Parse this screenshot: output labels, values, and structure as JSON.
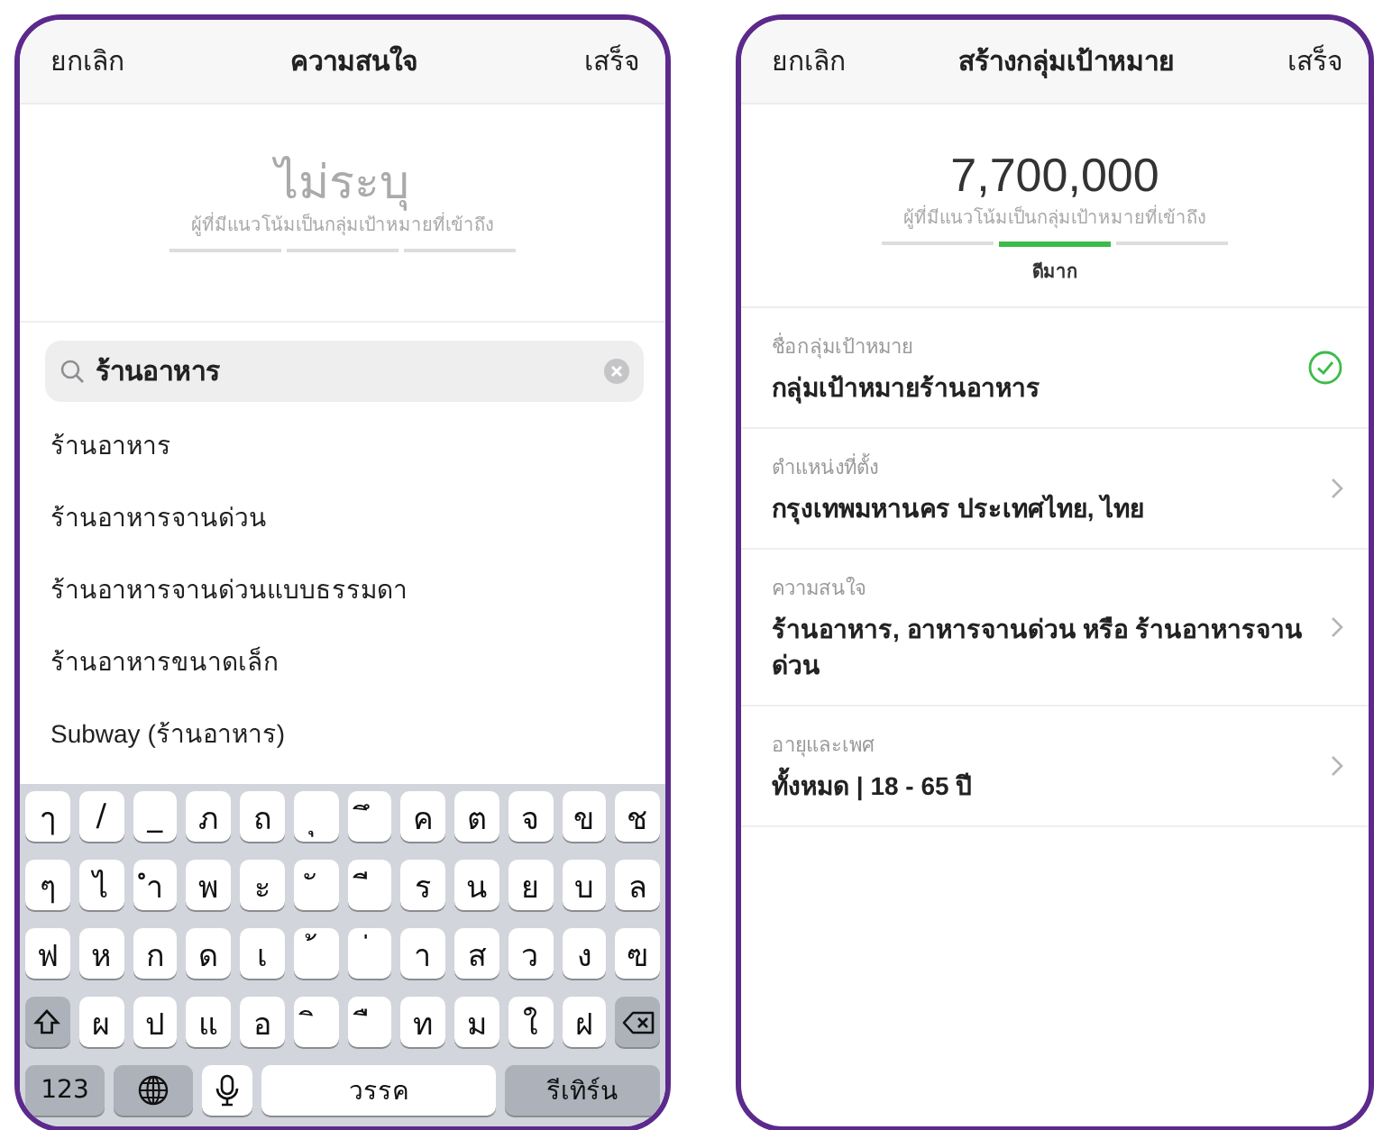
{
  "left_screen": {
    "header": {
      "cancel": "ยกเลิก",
      "title": "ความสนใจ",
      "done": "เสร็จ"
    },
    "audience": {
      "size": "ไม่ระบุ",
      "caption": "ผู้ที่มีแนวโน้มเป็นกลุ่มเป้าหมายที่เข้าถึง",
      "segments": [
        {
          "on": false
        },
        {
          "on": false
        },
        {
          "on": false
        }
      ]
    },
    "search": {
      "value": "ร้านอาหาร"
    },
    "results": [
      "ร้านอาหาร",
      "ร้านอาหารจานด่วน",
      "ร้านอาหารจานด่วนแบบธรรมดา",
      "ร้านอาหารขนาดเล็ก",
      "Subway (ร้านอาหาร)"
    ],
    "keyboard": {
      "rows": [
        [
          "ๅ",
          "/",
          "_",
          "ภ",
          "ถ",
          "ุ",
          "ึ",
          "ค",
          "ต",
          "จ",
          "ข",
          "ช"
        ],
        [
          "ๆ",
          "ไ",
          "ำ",
          "พ",
          "ะ",
          "ั",
          "ี",
          "ร",
          "น",
          "ย",
          "บ",
          "ล"
        ],
        [
          "ฟ",
          "ห",
          "ก",
          "ด",
          "เ",
          "้",
          "่",
          "า",
          "ส",
          "ว",
          "ง",
          "ฃ"
        ]
      ],
      "shift_row": {
        "letters": [
          "ผ",
          "ป",
          "แ",
          "อ",
          "ิ",
          "ื",
          "ท",
          "ม",
          "ใ",
          "ฝ"
        ]
      },
      "numbers_key": "123",
      "space_key": "วรรค",
      "return_key": "รีเทิร์น"
    }
  },
  "right_screen": {
    "header": {
      "cancel": "ยกเลิก",
      "title": "สร้างกลุ่มเป้าหมาย",
      "done": "เสร็จ"
    },
    "audience": {
      "size": "7,700,000",
      "caption": "ผู้ที่มีแนวโน้มเป็นกลุ่มเป้าหมายที่เข้าถึง",
      "segments": [
        {
          "on": false
        },
        {
          "on": true
        },
        {
          "on": false
        }
      ],
      "rating": "ดีมาก"
    },
    "fields": [
      {
        "kind": "check",
        "label": "ชื่อกลุ่มเป้าหมาย",
        "value": "กลุ่มเป้าหมายร้านอาหาร"
      },
      {
        "kind": "chevron",
        "label": "ตำแหน่งที่ตั้ง",
        "value": "กรุงเทพมหานคร ประเทศไทย, ไทย"
      },
      {
        "kind": "chevron",
        "label": "ความสนใจ",
        "value": "ร้านอาหาร, อาหารจานด่วน หรือ ร้านอาหารจาน ด่วน"
      },
      {
        "kind": "chevron",
        "label": "อายุและเพศ",
        "value": "ทั้งหมด | 18 - 65 ปี"
      }
    ]
  }
}
